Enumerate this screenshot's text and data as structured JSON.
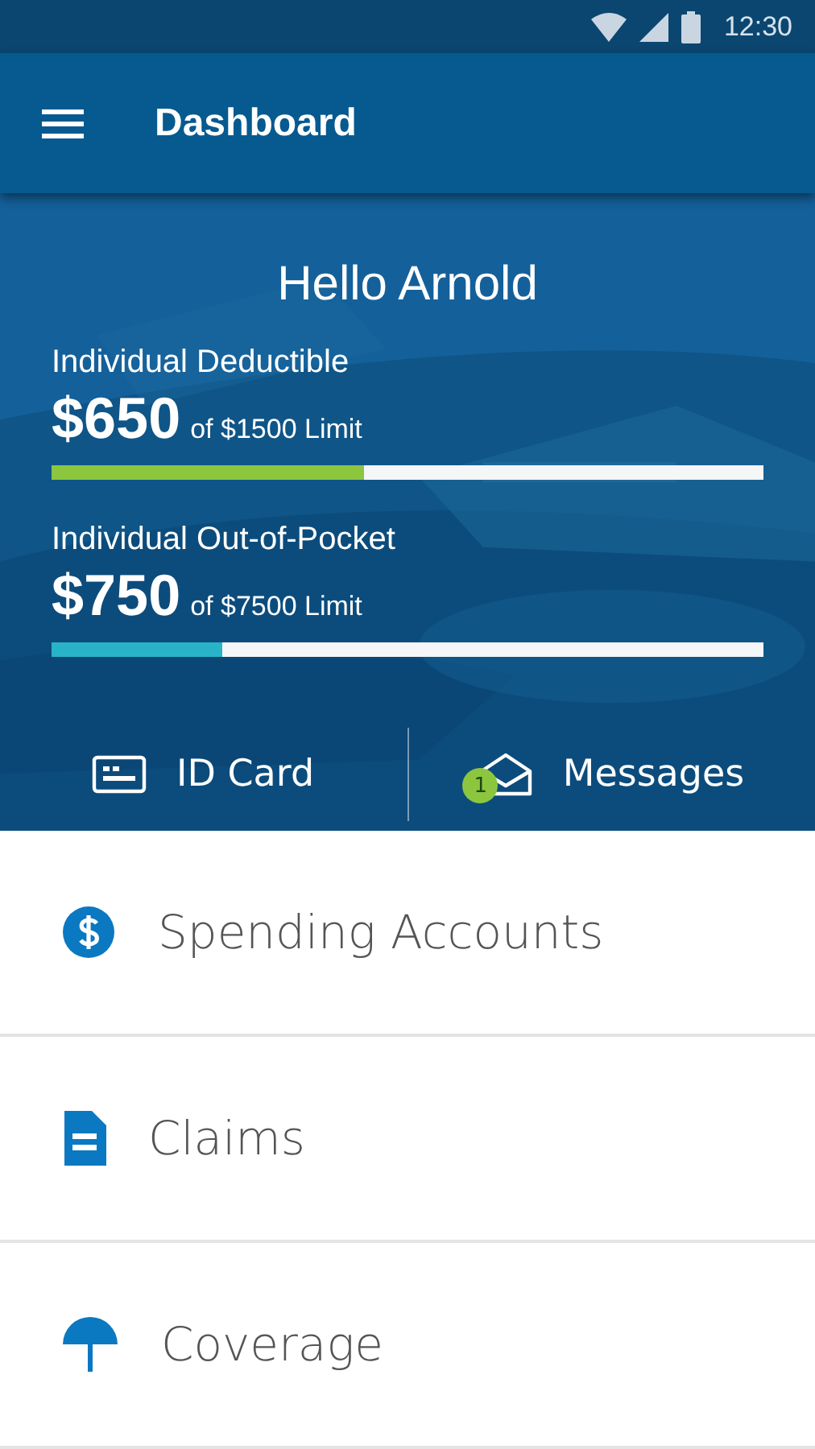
{
  "status_bar": {
    "time": "12:30"
  },
  "app_bar": {
    "title": "Dashboard"
  },
  "greeting": "Hello Arnold",
  "meters": [
    {
      "label": "Individual Deductible",
      "amount": "$650",
      "limit": "of $1500 Limit",
      "level": 0.44,
      "color": "#8cc63f"
    },
    {
      "label": "Individual Out-of-Pocket",
      "amount": "$750",
      "limit": "of $7500 Limit",
      "level": 0.24,
      "color": "#29b3c9"
    }
  ],
  "actions": [
    {
      "kind": "card",
      "label": "ID Card"
    },
    {
      "kind": "messages",
      "label": "Messages",
      "badge": "1"
    }
  ],
  "menu": [
    {
      "kind": "dollar",
      "label": "Spending Accounts"
    },
    {
      "kind": "document",
      "label": "Claims"
    },
    {
      "kind": "umbrella",
      "label": "Coverage"
    }
  ]
}
